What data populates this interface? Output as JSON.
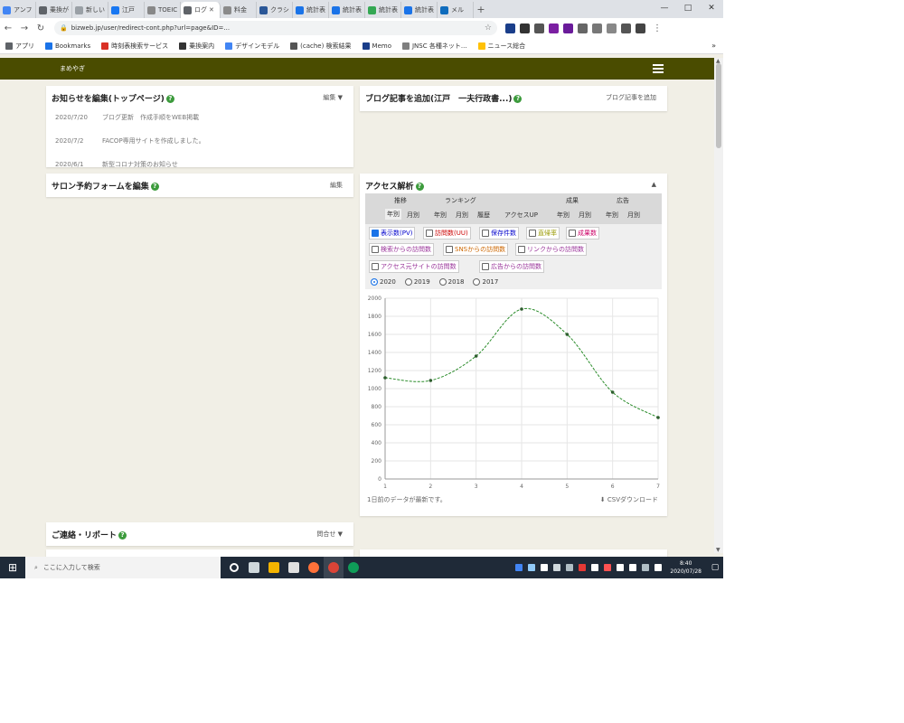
{
  "browser": {
    "tabs": [
      {
        "label": "アンフ",
        "color": "#4285f4"
      },
      {
        "label": "乗換が",
        "color": "#5f6368"
      },
      {
        "label": "新しいタブ",
        "color": "#9aa0a6"
      },
      {
        "label": "江戸",
        "color": "#1877f2"
      },
      {
        "label": "TOEIC",
        "color": "#888888"
      },
      {
        "label": "ログ",
        "color": "#5f6368",
        "active": true
      },
      {
        "label": "料金",
        "color": "#8a8a8a"
      },
      {
        "label": "クラシ",
        "color": "#2b5797"
      },
      {
        "label": "統計表",
        "color": "#1a73e8"
      },
      {
        "label": "統計表",
        "color": "#1a73e8"
      },
      {
        "label": "統計表",
        "color": "#34a853"
      },
      {
        "label": "統計表",
        "color": "#1a73e8"
      },
      {
        "label": "メル",
        "color": "#0f6cbd"
      }
    ],
    "new_tab": "+",
    "window_controls": [
      "—",
      "□",
      "✕"
    ],
    "url": "bizweb.jp/user/redirect-cont.php?url=page&ID=...",
    "bookmarks": [
      {
        "label": "アプリ",
        "color": "#5f6368"
      },
      {
        "label": "Bookmarks",
        "color": "#1a73e8"
      },
      {
        "label": "時刻表検索サービス",
        "color": "#d93025"
      },
      {
        "label": "乗換案内",
        "color": "#333333"
      },
      {
        "label": "デザインモデル",
        "color": "#4285f4"
      },
      {
        "label": "(cache) 検索結果",
        "color": "#555555"
      },
      {
        "label": "Memo",
        "color": "#1a3e8a"
      },
      {
        "label": "JNSC 各種ネット...",
        "color": "#7f7f7f"
      },
      {
        "label": "ニュース総合",
        "color": "#ffc107"
      }
    ],
    "bookmarks_more": "»",
    "ext_colors": [
      "#1a3e8a",
      "#333333",
      "#555555",
      "#7b1fa2",
      "#6a1b9a",
      "#666666",
      "#777777",
      "#888888",
      "#555555",
      "#444444"
    ]
  },
  "site": {
    "name": "まめやぎ"
  },
  "news_panel": {
    "title": "お知らせを編集(トップページ)",
    "right": "編集 ▼",
    "items": [
      {
        "date": "2020/7/20",
        "text": "ブログ更新　作成手順をWEB掲載"
      },
      {
        "date": "2020/7/2",
        "text": "FACOP専用サイトを作成しました。"
      },
      {
        "date": "2020/6/1",
        "text": "新型コロナ対策のお知らせ"
      }
    ]
  },
  "blog_panel": {
    "title": "ブログ記事を追加(江戸　一夫行政書...)",
    "right": "ブログ記事を追加"
  },
  "salon_panel": {
    "title": "サロン予約フォームを編集",
    "right": "編集"
  },
  "contact_panel": {
    "title": "ご連絡・リポート",
    "right": "問合せ ▼"
  },
  "analytics": {
    "title": "アクセス解析",
    "collapse": "▲",
    "groups": [
      "推移",
      "ランキング",
      "成果",
      "広告"
    ],
    "subtabs": [
      "年別",
      "月別",
      "年別",
      "月別",
      "履歴",
      "アクセスUP",
      "年別",
      "月別",
      "年別",
      "月別"
    ],
    "metrics": [
      {
        "label": "表示数(PV)",
        "checked": true,
        "color": "#0000cc"
      },
      {
        "label": "訪問数(UU)",
        "checked": false,
        "color": "#cc0000"
      },
      {
        "label": "保存件数",
        "checked": false,
        "color": "#0000cc"
      },
      {
        "label": "直帰率",
        "checked": false,
        "color": "#999900"
      },
      {
        "label": "成果数",
        "checked": false,
        "color": "#cc0066"
      },
      {
        "label": "検索からの訪問数",
        "checked": false,
        "color": "#993399"
      },
      {
        "label": "SNSからの訪問数",
        "checked": false,
        "color": "#cc6600"
      },
      {
        "label": "リンクからの訪問数",
        "checked": false,
        "color": "#993399"
      },
      {
        "label": "アクセス元サイトの訪問数",
        "checked": false,
        "color": "#993399"
      },
      {
        "label": "広告からの訪問数",
        "checked": false,
        "color": "#993399"
      }
    ],
    "years": [
      {
        "label": "2020",
        "selected": true
      },
      {
        "label": "2019",
        "selected": false
      },
      {
        "label": "2018",
        "selected": false
      },
      {
        "label": "2017",
        "selected": false
      }
    ],
    "footnote": "1日前のデータが最新です。",
    "download": "CSVダウンロード"
  },
  "chart_data": {
    "type": "line",
    "x": [
      1,
      2,
      3,
      4,
      5,
      6,
      7
    ],
    "series": [
      {
        "values": [
          1120,
          1090,
          1360,
          1880,
          1600,
          960,
          680
        ]
      }
    ],
    "ylim": [
      0,
      2000
    ],
    "yticks": [
      0,
      200,
      400,
      600,
      800,
      1000,
      1200,
      1400,
      1600,
      1800,
      2000
    ],
    "grid": true,
    "color": "#2a8c2a"
  },
  "taskbar": {
    "start": "⊞",
    "search": "ここに入力して検索",
    "apps": [
      {
        "name": "cortana",
        "color": "#ffffff",
        "round": true
      },
      {
        "name": "taskview",
        "color": "#cfd8dc"
      },
      {
        "name": "explorer",
        "color": "#f4b400"
      },
      {
        "name": "store",
        "color": "#e0e0e0"
      },
      {
        "name": "firefox",
        "color": "#ff7139",
        "round": true
      },
      {
        "name": "chrome",
        "color": "#db4437",
        "round": true,
        "active": true
      },
      {
        "name": "edge",
        "color": "#0f9d58",
        "round": true
      }
    ],
    "tray_colors": [
      "#4285f4",
      "#90caf9",
      "#ffffff",
      "#cfd8dc",
      "#b0bec5",
      "#e53935",
      "#ffffff",
      "#ff5252",
      "#ffffff",
      "#ffffff",
      "#b0bec5",
      "#ffffff"
    ],
    "clock_time": "8:40",
    "clock_date": "2020/07/28",
    "notif": "▢"
  }
}
